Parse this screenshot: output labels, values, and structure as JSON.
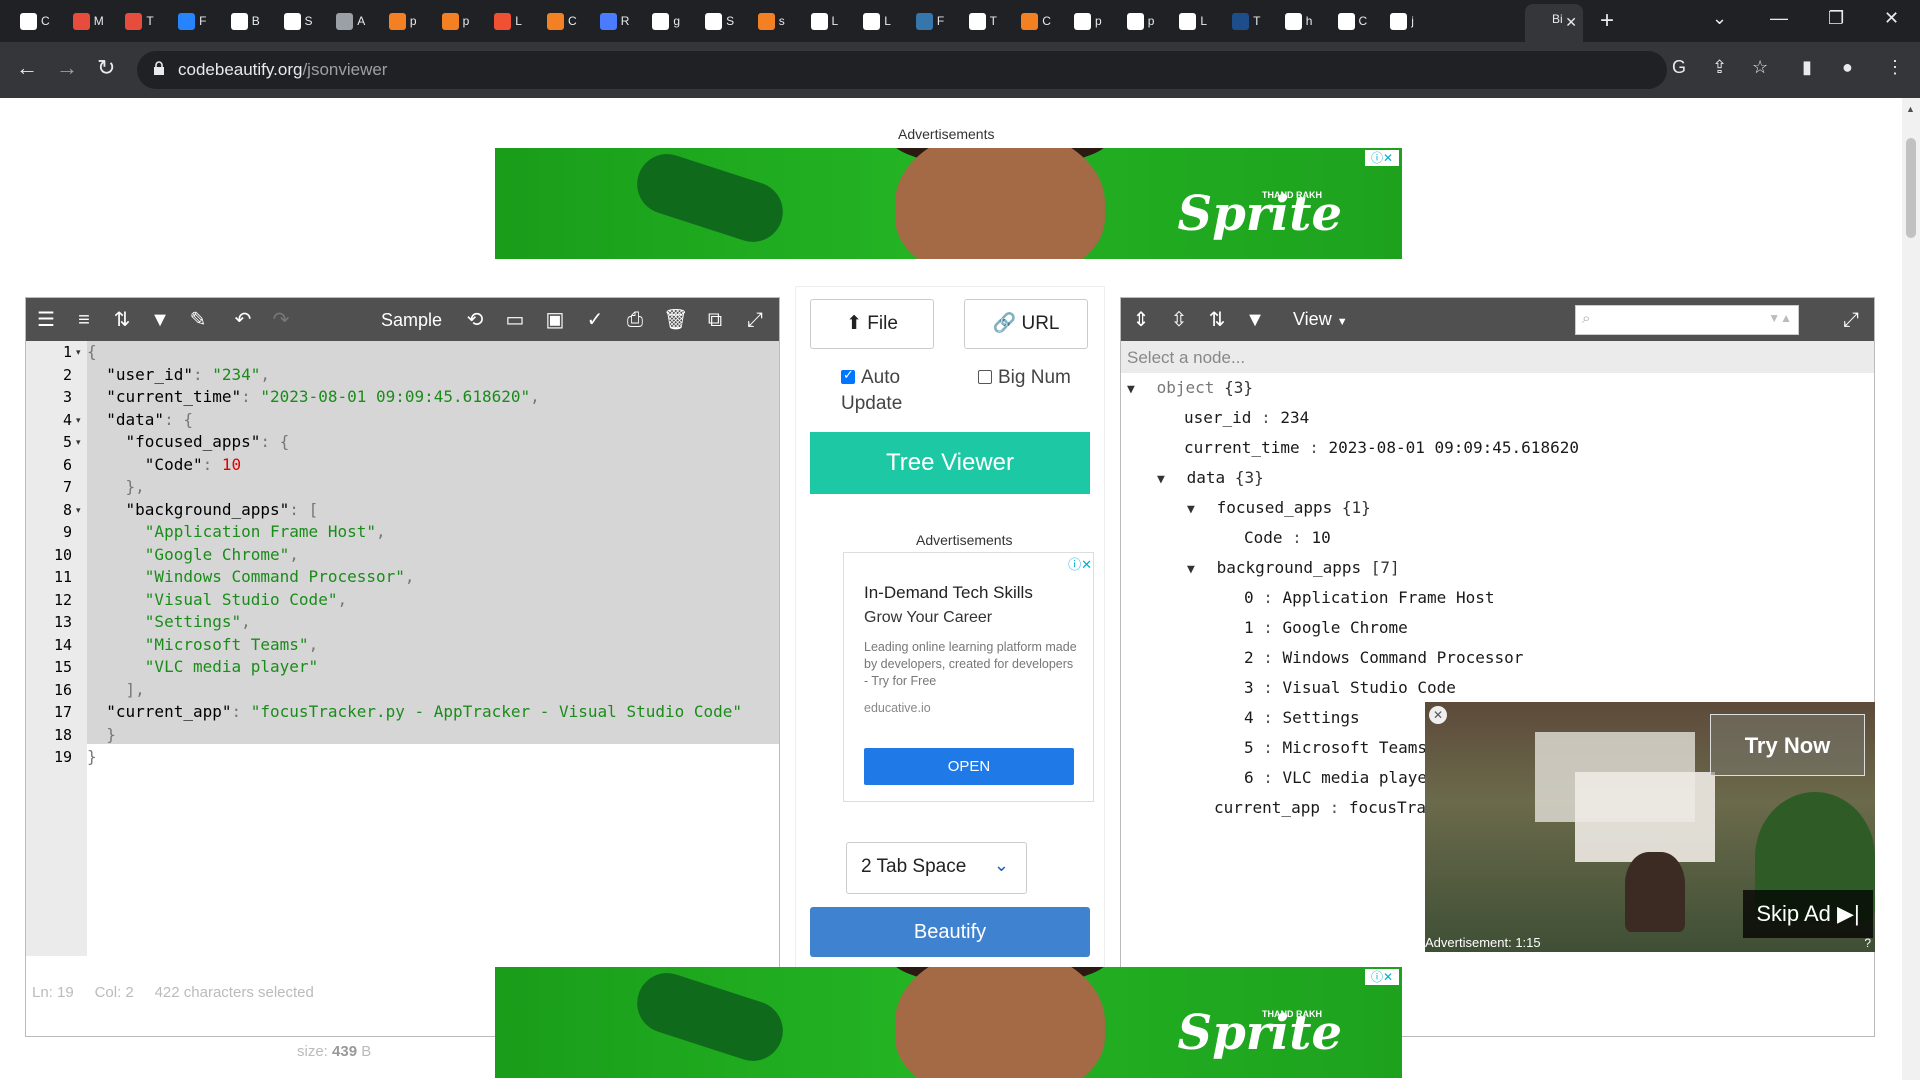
{
  "browser": {
    "tabs": [
      {
        "icon": "openai-icon",
        "title": "C",
        "color": "#ffffff"
      },
      {
        "icon": "app-icon",
        "title": "M",
        "color": "#e74c3c"
      },
      {
        "icon": "app-icon",
        "title": "T",
        "color": "#e74c3c"
      },
      {
        "icon": "confluence-icon",
        "title": "F",
        "color": "#2684ff"
      },
      {
        "icon": "mail-icon",
        "title": "B",
        "color": "#ffffff"
      },
      {
        "icon": "google-icon",
        "title": "S",
        "color": "#ffffff"
      },
      {
        "icon": "globe-icon",
        "title": "A",
        "color": "#9aa0a6"
      },
      {
        "icon": "stackoverflow-icon",
        "title": "p",
        "color": "#f48024"
      },
      {
        "icon": "stackoverflow-icon",
        "title": "p",
        "color": "#f48024"
      },
      {
        "icon": "git-icon",
        "title": "L",
        "color": "#f05133"
      },
      {
        "icon": "stackoverflow-icon",
        "title": "C",
        "color": "#f48024"
      },
      {
        "icon": "people-icon",
        "title": "R",
        "color": "#4a7cff"
      },
      {
        "icon": "google-icon",
        "title": "g",
        "color": "#ffffff"
      },
      {
        "icon": "google-icon",
        "title": "S",
        "color": "#ffffff"
      },
      {
        "icon": "stackoverflow-icon",
        "title": "s",
        "color": "#f48024"
      },
      {
        "icon": "bookmark-icon",
        "title": "L",
        "color": "#ffffff"
      },
      {
        "icon": "b-icon",
        "title": "L",
        "color": "#ffffff"
      },
      {
        "icon": "python-icon",
        "title": "F",
        "color": "#3776ab"
      },
      {
        "icon": "medium-icon",
        "title": "T",
        "color": "#ffffff"
      },
      {
        "icon": "stackoverflow-icon",
        "title": "C",
        "color": "#f48024"
      },
      {
        "icon": "github-icon",
        "title": "p",
        "color": "#ffffff"
      },
      {
        "icon": "github-icon",
        "title": "p",
        "color": "#ffffff"
      },
      {
        "icon": "bookmark-icon",
        "title": "L",
        "color": "#ffffff"
      },
      {
        "icon": "tds-icon",
        "title": "T",
        "color": "#1e4d8c"
      },
      {
        "icon": "google-icon",
        "title": "h",
        "color": "#ffffff"
      },
      {
        "icon": "github-icon",
        "title": "C",
        "color": "#ffffff"
      },
      {
        "icon": "google-icon",
        "title": "j",
        "color": "#ffffff"
      }
    ],
    "active_tab_title": "Bi",
    "url_host": "codebeautify.org",
    "url_path": "/jsonviewer"
  },
  "ads": {
    "label": "Advertisements",
    "banner_brand": "Sprite",
    "banner_tag": "THAND RAKH"
  },
  "left_panel": {
    "sample_label": "Sample",
    "lines": [
      "1",
      "2",
      "3",
      "4",
      "5",
      "6",
      "7",
      "8",
      "9",
      "10",
      "11",
      "12",
      "13",
      "14",
      "15",
      "16",
      "17",
      "18",
      "19"
    ],
    "status_ln": "Ln: 19",
    "status_col": "Col: 2",
    "status_sel": "422 characters selected",
    "size_label": "size:",
    "size_value": "439",
    "size_unit": "B"
  },
  "code": {
    "user_id_key": "\"user_id\"",
    "user_id_val": "\"234\"",
    "current_time_key": "\"current_time\"",
    "current_time_val": "\"2023-08-01 09:09:45.618620\"",
    "data_key": "\"data\"",
    "focused_apps_key": "\"focused_apps\"",
    "code_key": "\"Code\"",
    "code_val": "10",
    "background_apps_key": "\"background_apps\"",
    "apps": [
      "\"Application Frame Host\"",
      "\"Google Chrome\"",
      "\"Windows Command Processor\"",
      "\"Visual Studio Code\"",
      "\"Settings\"",
      "\"Microsoft Teams\"",
      "\"VLC media player\""
    ],
    "current_app_key": "\"current_app\"",
    "current_app_val": "\"focusTracker.py - AppTracker - Visual Studio Code\""
  },
  "middle": {
    "file_label": "File",
    "url_label": "URL",
    "auto_update_line1": "Auto",
    "auto_update_line2": "Update",
    "auto_update_checked": true,
    "big_num_label": "Big Num",
    "big_num_checked": false,
    "tree_viewer_label": "Tree Viewer",
    "ad_label": "Advertisements",
    "ad_title": "In-Demand Tech Skills",
    "ad_subtitle": "Grow Your Career",
    "ad_body": "Leading online learning platform made by developers, created for developers - Try for Free",
    "ad_source": "educative.io",
    "ad_cta": "OPEN",
    "tab_space_value": "2 Tab Space",
    "beautify_label": "Beautify"
  },
  "right_panel": {
    "view_label": "View",
    "crumb": "Select a node...",
    "tree": {
      "root_label": "object",
      "root_count": "{3}",
      "user_id_key": "user_id",
      "user_id_val": "234",
      "current_time_key": "current_time",
      "current_time_val": "2023-08-01 09:09:45.618620",
      "data_key": "data",
      "data_count": "{3}",
      "focused_key": "focused_apps",
      "focused_count": "{1}",
      "code_key": "Code",
      "code_val": "10",
      "bg_key": "background_apps",
      "bg_count": "[7]",
      "bg_items": [
        {
          "idx": "0",
          "val": "Application Frame Host"
        },
        {
          "idx": "1",
          "val": "Google Chrome"
        },
        {
          "idx": "2",
          "val": "Windows Command Processor"
        },
        {
          "idx": "3",
          "val": "Visual Studio Code"
        },
        {
          "idx": "4",
          "val": "Settings"
        },
        {
          "idx": "5",
          "val": "Microsoft Teams"
        },
        {
          "idx": "6",
          "val": "VLC media player"
        }
      ],
      "current_app_key": "current_app",
      "current_app_val": "focusTrac"
    },
    "video_ad": {
      "try_now": "Try Now",
      "skip_ad": "Skip Ad",
      "timer": "Advertisement: 1:15"
    }
  }
}
